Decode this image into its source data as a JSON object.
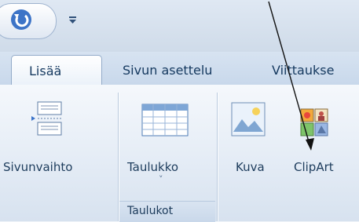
{
  "tabs": [
    {
      "label": "Lisää",
      "active": true
    },
    {
      "label": "Sivun asettelu",
      "active": false
    },
    {
      "label": "Viittaukse",
      "active": false
    }
  ],
  "ribbon": {
    "buttons": {
      "page_break": {
        "label": "Sivunvaihto",
        "icon": "page-break-icon"
      },
      "table": {
        "label": "Taulukko",
        "icon": "table-icon",
        "dropdown": "˅"
      },
      "picture": {
        "label": "Kuva",
        "icon": "picture-icon"
      },
      "clipart": {
        "label": "ClipArt",
        "icon": "clipart-icon"
      }
    },
    "groups": {
      "tables": "Taulukot"
    }
  },
  "colors": {
    "accent": "#15395f",
    "ribbon_bg": "#e3ebf5",
    "tab_bar": "#c8d8eb"
  }
}
